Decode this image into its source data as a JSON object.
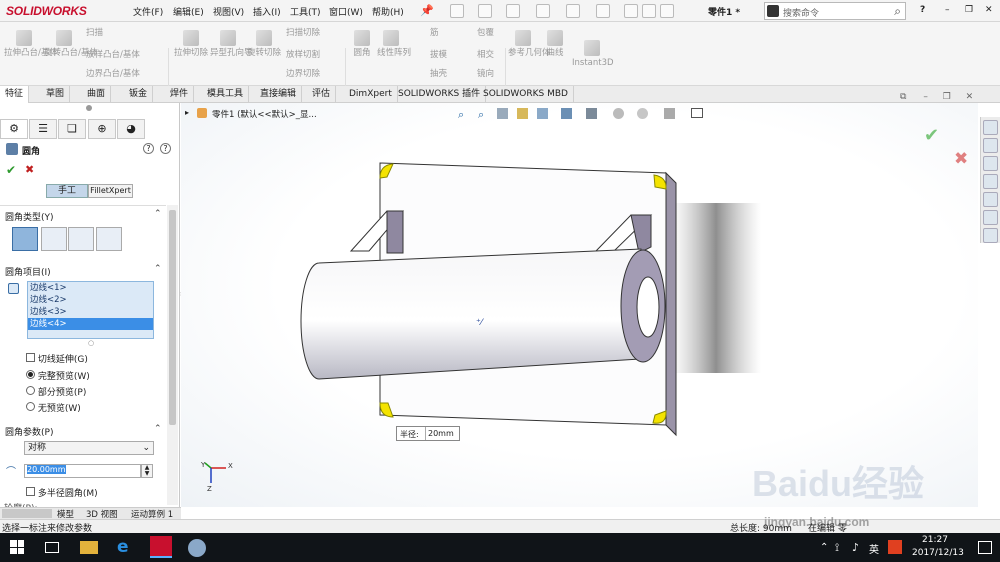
{
  "app": {
    "logo_text": "SOLIDWORKS",
    "doc_title": "零件1 *",
    "brand_color": "#c8102e"
  },
  "menu": [
    "文件(F)",
    "编辑(E)",
    "视图(V)",
    "插入(I)",
    "工具(T)",
    "窗口(W)",
    "帮助(H)"
  ],
  "search": {
    "placeholder": "搜索命令"
  },
  "window_controls": {
    "help": "?",
    "minimize": "–",
    "restore": "❐",
    "close": "✕"
  },
  "ribbon": {
    "items": [
      "拉伸凸台/基体",
      "旋转凸台/基体",
      "扫描",
      "放样凸台/基体",
      "边界凸台/基体",
      "拉伸切除",
      "异型孔向导",
      "旋转切除",
      "扫描切除",
      "放样切割",
      "边界切除",
      "圆角",
      "线性阵列",
      "筋",
      "拔模",
      "抽壳",
      "包覆",
      "相交",
      "镜向",
      "参考几何体",
      "曲线",
      "Instant3D"
    ]
  },
  "tabs": [
    "特征",
    "草图",
    "曲面",
    "钣金",
    "焊件",
    "模具工具",
    "直接编辑",
    "评估",
    "DimXpert",
    "SOLIDWORKS 插件",
    "SOLIDWORKS MBD"
  ],
  "tree": {
    "title": "零件1 (默认<<默认>_显..."
  },
  "property_manager": {
    "title": "圆角",
    "mode_manual": "手工",
    "mode_fx": "FilletXpert",
    "fillet_type_header": "圆角类型(Y)",
    "items_header": "圆角项目(I)",
    "edges": [
      "边线<1>",
      "边线<2>",
      "边线<3>",
      "边线<4>"
    ],
    "tangent_label": "切线延伸(G)",
    "preview_full": "完整预览(W)",
    "preview_partial": "部分预览(P)",
    "preview_none": "无预览(W)",
    "params_header": "圆角参数(P)",
    "method_value": "对称",
    "radius_value": "20.00mm",
    "multi_radius_label": "多半径圆角(M)",
    "profile_label": "轮廓(P):"
  },
  "callout": {
    "label": "半径:",
    "value": "20mm"
  },
  "axes": {
    "x": "X",
    "y": "Y",
    "z": "Z"
  },
  "bottom_tabs": [
    "模型",
    "3D 视图",
    "运动算例 1"
  ],
  "status": {
    "message": "选择一标注来修改参数",
    "length": "总长度: 90mm",
    "editing": "在编辑 零"
  },
  "taskbar": {
    "ime": "英",
    "time": "21:27",
    "date": "2017/12/13"
  },
  "watermark": {
    "brand": "Baidu经验",
    "url": "jingyan.baidu.com"
  }
}
